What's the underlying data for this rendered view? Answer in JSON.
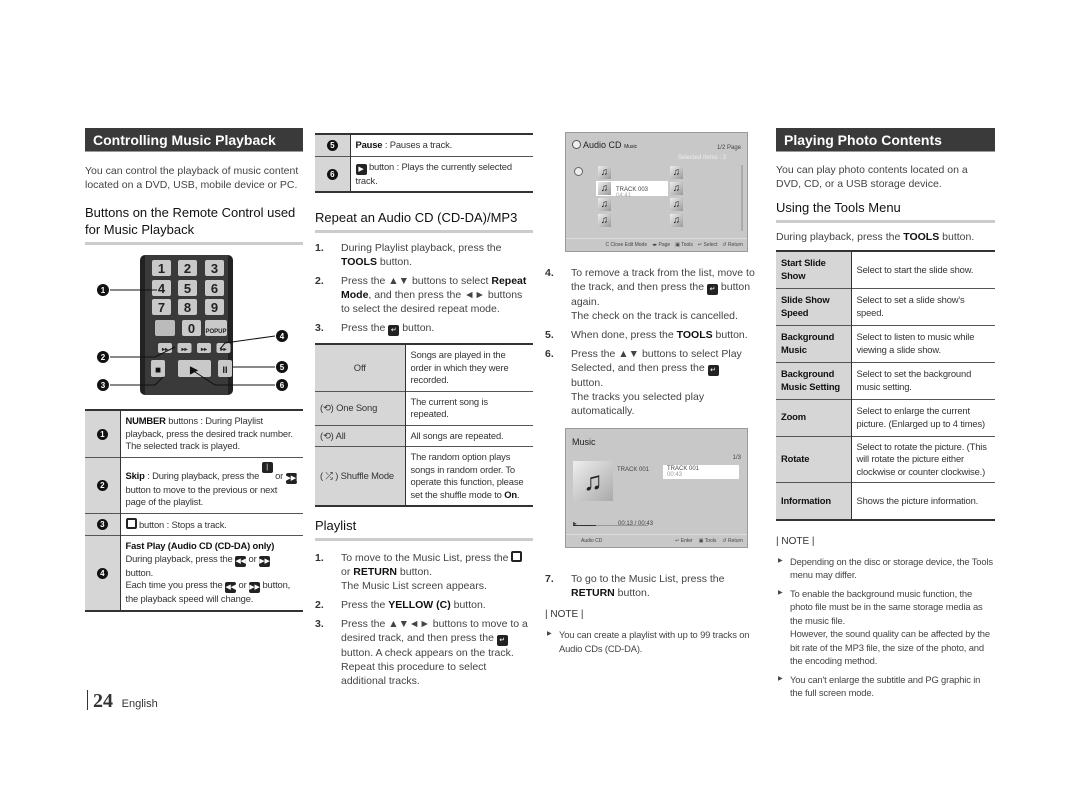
{
  "col1": {
    "title": "Controlling Music Playback",
    "intro": "You can control the playback of music content located on a DVD, USB, mobile device or PC.",
    "subheading": "Buttons on the Remote Control used for Music Playback",
    "remote": {
      "keys": [
        "1",
        "2",
        "3",
        "4",
        "5",
        "6",
        "7",
        "8",
        "9",
        "0",
        "POPUP"
      ],
      "callouts": [
        "1",
        "2",
        "3",
        "4",
        "5",
        "6"
      ]
    },
    "table": [
      {
        "num": "1",
        "text": [
          {
            "b": "NUMBER"
          },
          " buttons : During Playlist playback, press the desired track number.",
          {
            "br": 1
          },
          "The selected track is played."
        ]
      },
      {
        "num": "2",
        "text": [
          {
            "b": "Skip"
          },
          " : During playback, press the ",
          {
            "icon": "prev"
          },
          " or ",
          {
            "icon": "next"
          },
          " button to move to the previous or next page of the playlist."
        ]
      },
      {
        "num": "3",
        "text": [
          {
            "icon": "stop"
          },
          " button : Stops a track."
        ]
      },
      {
        "num": "4",
        "text": [
          {
            "b": "Fast Play (Audio CD (CD-DA) only)"
          },
          {
            "br": 1
          },
          "During playback, press the ",
          {
            "icon": "rew"
          },
          " or ",
          {
            "icon": "ff"
          },
          {
            "br": 1
          },
          "button.",
          {
            "br": 1
          },
          "Each time you press the ",
          {
            "icon": "rew"
          },
          " or ",
          {
            "icon": "ff"
          },
          " button, the playback speed will change."
        ]
      }
    ]
  },
  "col2": {
    "table": [
      {
        "num": "5",
        "text": [
          {
            "b": "Pause"
          },
          " : Pauses a track."
        ]
      },
      {
        "num": "6",
        "text": [
          {
            "icon": "play"
          },
          " button : Plays the currently selected track."
        ]
      }
    ],
    "repeat_heading": "Repeat an Audio CD (CD-DA)/MP3",
    "repeat_steps": [
      {
        "n": "1.",
        "text": [
          "During Playlist playback, press the ",
          {
            "b": "TOOLS"
          },
          " button."
        ]
      },
      {
        "n": "2.",
        "text": [
          "Press the ▲▼ buttons to select ",
          {
            "b": "Repeat Mode"
          },
          ", and then press the ◄► buttons to select the desired repeat mode."
        ]
      },
      {
        "n": "3.",
        "text": [
          "Press the ",
          {
            "icon": "enter"
          },
          " button."
        ]
      }
    ],
    "repeat_table": [
      {
        "icon": "",
        "mode": "Off",
        "desc": "Songs are played in the order in which they were recorded."
      },
      {
        "icon": "repeat-one",
        "mode": "One Song",
        "desc": "The current song is repeated."
      },
      {
        "icon": "repeat-all",
        "mode": "All",
        "desc": "All songs are repeated."
      },
      {
        "icon": "shuffle",
        "mode": "Shuffle Mode",
        "desc": [
          "The random option plays songs in random order. To operate this function, please set the shuffle mode to ",
          {
            "b": "On"
          },
          "."
        ]
      }
    ],
    "playlist_heading": "Playlist",
    "playlist_steps": [
      {
        "n": "1.",
        "text": [
          "To move to the Music List, press the ",
          {
            "icon": "stop"
          },
          {
            "br": 1
          },
          "or ",
          {
            "b": "RETURN"
          },
          " button.",
          {
            "br": 1
          },
          "The Music List screen appears."
        ]
      },
      {
        "n": "2.",
        "text": [
          "Press the ",
          {
            "b": "YELLOW (C)"
          },
          " button."
        ]
      },
      {
        "n": "3.",
        "text": [
          "Press the ▲▼◄► buttons to move to a desired track, and then press the ",
          {
            "icon": "enter"
          },
          " button. A check appears on the track. Repeat this procedure to select additional tracks."
        ]
      }
    ]
  },
  "col3": {
    "screen1": {
      "title": "Audio CD",
      "subtitle": "Music",
      "page": "1/2 Page",
      "selected": "Selected Items : 3",
      "selected_track": "TRACK 003",
      "selected_time": "04:41",
      "footer": [
        "Close Edit Mode",
        "Page",
        "Tools",
        "Select",
        "Return"
      ]
    },
    "steps": [
      {
        "n": "4.",
        "text": [
          "To remove a track from the list, move to the track, and then press the ",
          {
            "icon": "enter"
          },
          " button again.",
          {
            "br": 1
          },
          "The check on the track is cancelled."
        ]
      },
      {
        "n": "5.",
        "text": [
          "When done, press the ",
          {
            "b": "TOOLS"
          },
          " button."
        ]
      },
      {
        "n": "6.",
        "text": [
          "Press the ▲▼ buttons to select Play Selected, and then press the ",
          {
            "icon": "enter"
          },
          {
            "br": 1
          },
          "button.",
          {
            "br": 1
          },
          "The tracks you selected play automatically."
        ]
      }
    ],
    "screen2": {
      "title": "Music",
      "page": "1/3",
      "now_track": "TRACK 001",
      "list_track": "TRACK 001",
      "list_time": "00:43",
      "time": "00:13 / 00:43",
      "source": "Audio CD",
      "footer": [
        "Enter",
        "Tools",
        "Return"
      ],
      "progress": 0.3
    },
    "step7": {
      "n": "7.",
      "text": [
        "To go to the Music List, press the ",
        {
          "b": "RETURN"
        },
        " button."
      ]
    },
    "note_label": "| NOTE |",
    "notes": [
      "You can create a playlist with up to 99 tracks on Audio CDs (CD-DA)."
    ]
  },
  "col4": {
    "title": "Playing Photo Contents",
    "intro": "You can play photo contents located on a DVD, CD, or a USB storage device.",
    "subheading": "Using the Tools Menu",
    "lead": [
      "During playback, press the ",
      {
        "b": "TOOLS"
      },
      " button."
    ],
    "table": [
      {
        "k": "Start Slide Show",
        "v": "Select to start the slide show."
      },
      {
        "k": "Slide Show Speed",
        "v": "Select to set a slide show's speed."
      },
      {
        "k": "Background Music",
        "v": "Select to listen to music while viewing a slide show."
      },
      {
        "k": "Background Music Setting",
        "v": "Select to set the background music setting."
      },
      {
        "k": "Zoom",
        "v": "Select to enlarge the current picture. (Enlarged up to 4 times)"
      },
      {
        "k": "Rotate",
        "v": "Select to rotate the picture. (This will rotate the picture either clockwise or counter clockwise.)"
      },
      {
        "k": "Information",
        "v": "Shows the picture information."
      }
    ],
    "note_label": "| NOTE |",
    "notes": [
      [
        "Depending on the disc or storage device, the Tools menu may differ."
      ],
      [
        "To enable the background music function, the photo file must be in the same storage media as the music file.",
        {
          "br": 1
        },
        "However, the sound quality can be affected by the bit rate of the MP3 file, the size of the photo, and the encoding method."
      ],
      [
        "You can't enlarge the subtitle and PG graphic in the full screen mode."
      ]
    ]
  },
  "footer": {
    "page": "24",
    "language": "English"
  }
}
